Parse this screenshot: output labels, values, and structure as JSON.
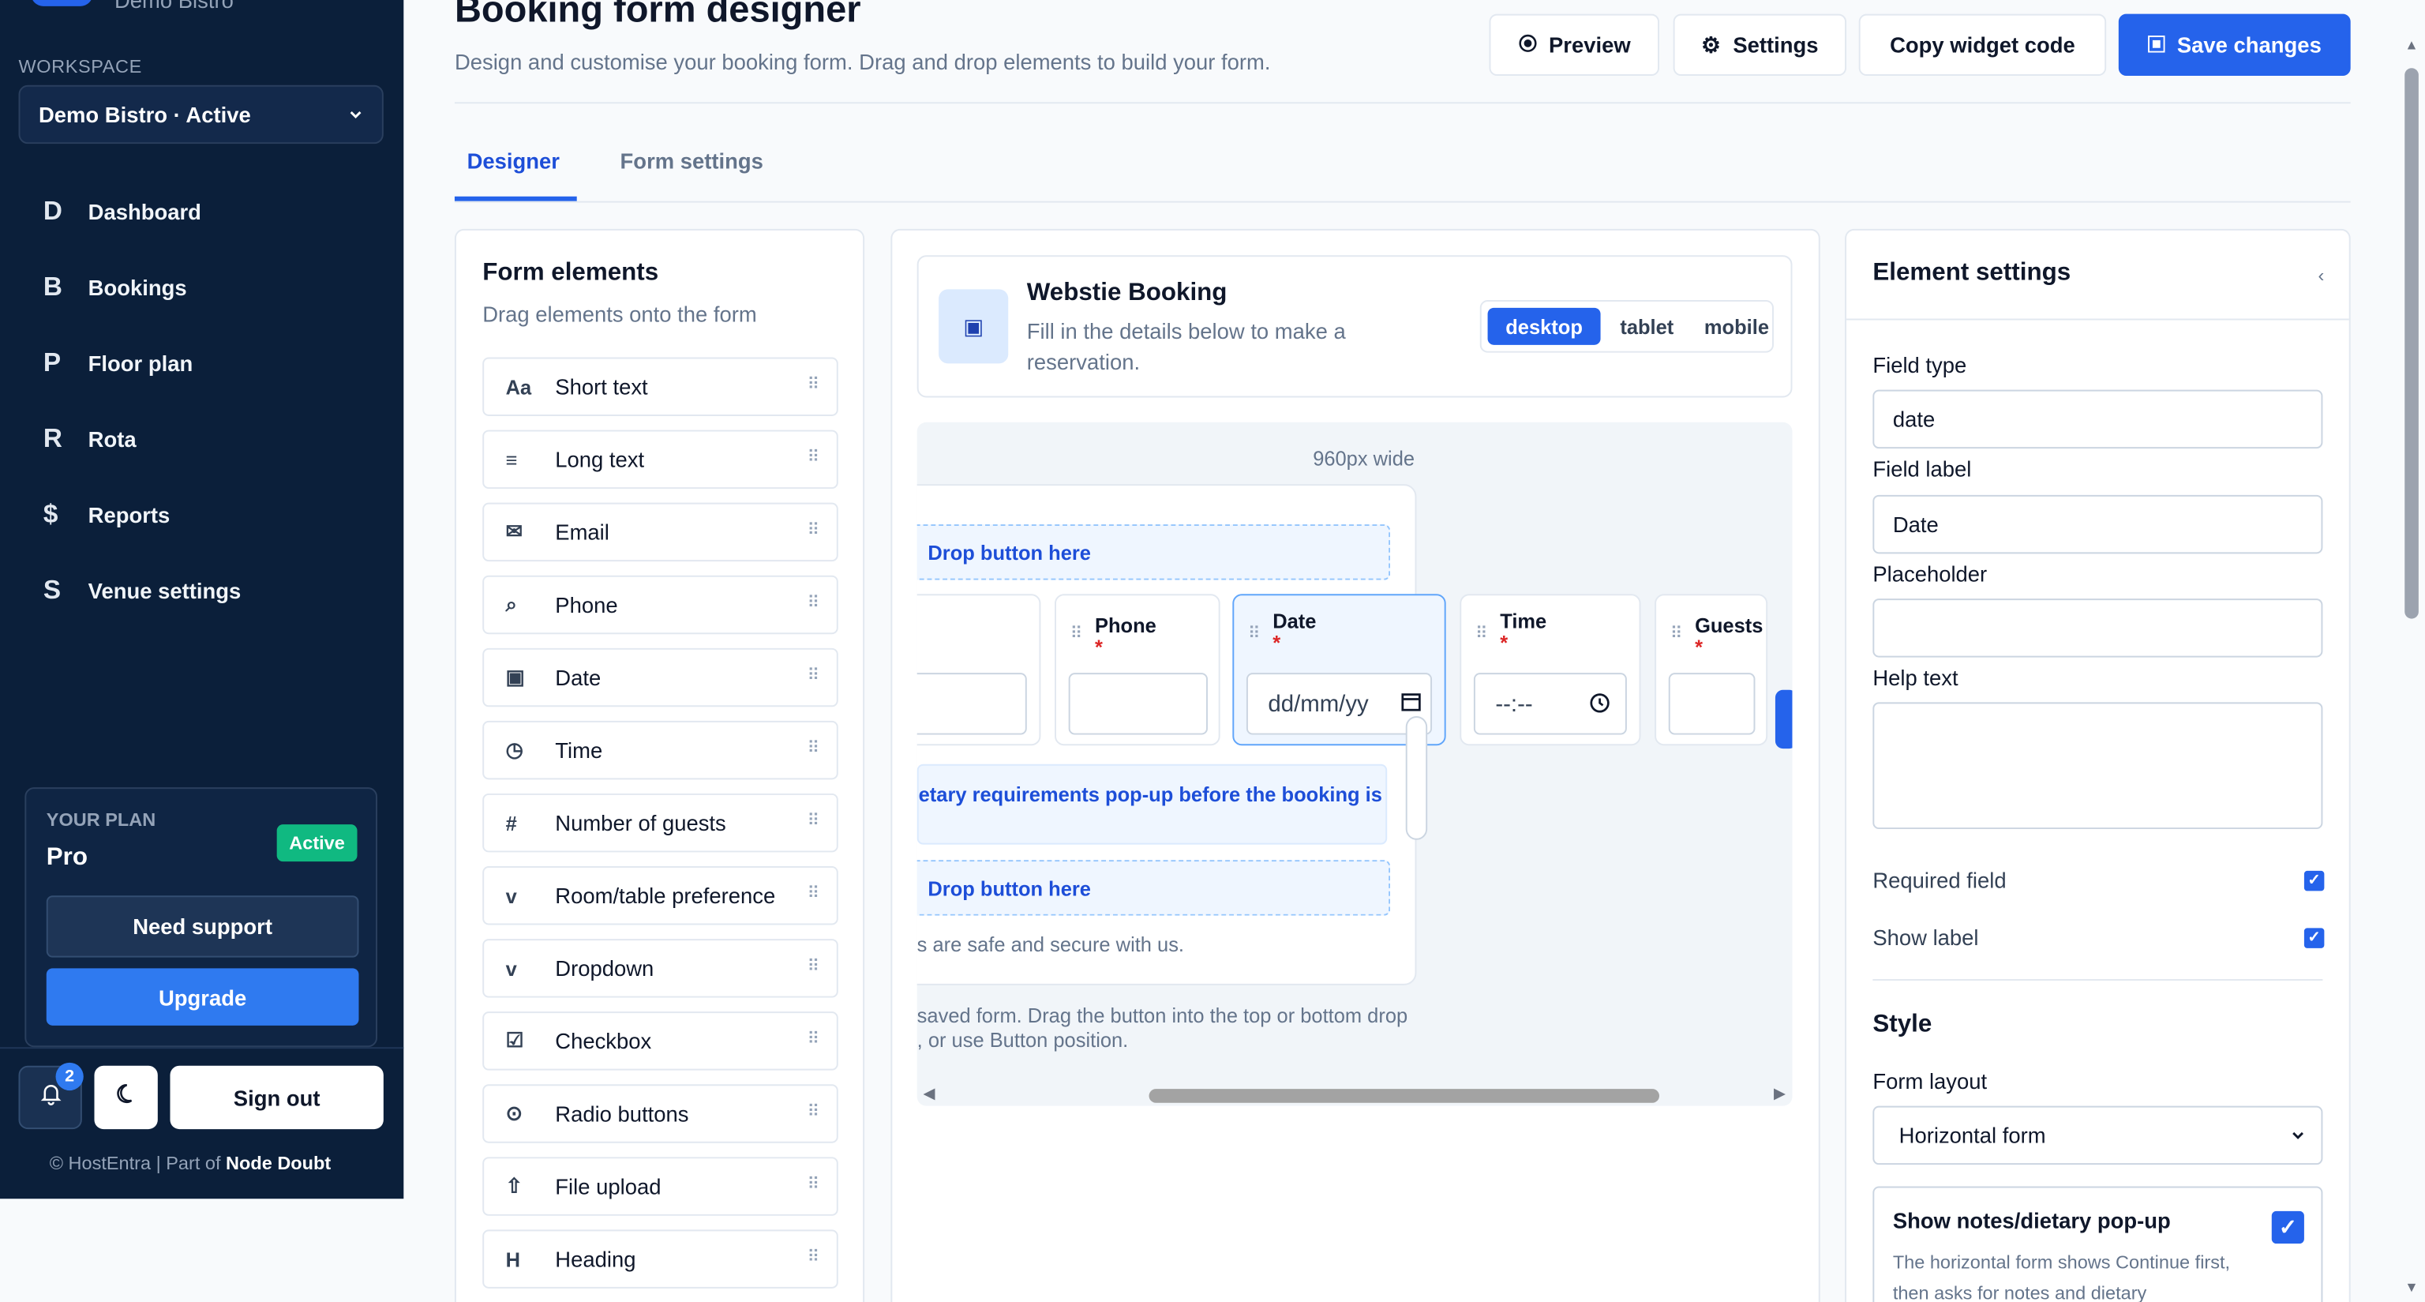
{
  "sidebar": {
    "brand": "Demo Bistro",
    "workspace_label": "WORKSPACE",
    "workspace_value": "Demo Bistro · Active",
    "nav": [
      {
        "icon": "D",
        "label": "Dashboard"
      },
      {
        "icon": "B",
        "label": "Bookings"
      },
      {
        "icon": "P",
        "label": "Floor plan"
      },
      {
        "icon": "R",
        "label": "Rota"
      },
      {
        "icon": "$",
        "label": "Reports"
      },
      {
        "icon": "S",
        "label": "Venue settings"
      }
    ],
    "plan": {
      "label": "YOUR PLAN",
      "name": "Pro",
      "badge": "Active",
      "support_label": "Need support",
      "upgrade_label": "Upgrade"
    },
    "notification_count": "2",
    "sign_out_label": "Sign out",
    "copyright_prefix": "© HostEntra | Part of ",
    "copyright_company": "Node Doubt"
  },
  "header": {
    "title": "Booking form designer",
    "subtitle": "Design and customise your booking form. Drag and drop elements to build your form.",
    "preview_label": "Preview",
    "settings_label": "Settings",
    "copy_label": "Copy widget code",
    "save_label": "Save changes"
  },
  "tabs": [
    {
      "label": "Designer",
      "active": true
    },
    {
      "label": "Form settings",
      "active": false
    }
  ],
  "form_elements": {
    "title": "Form elements",
    "subtitle": "Drag elements onto the form",
    "items": [
      {
        "icon": "Aa",
        "label": "Short text"
      },
      {
        "icon": "≡",
        "label": "Long text"
      },
      {
        "icon": "✉",
        "label": "Email"
      },
      {
        "icon": "⌕",
        "label": "Phone"
      },
      {
        "icon": "▣",
        "label": "Date"
      },
      {
        "icon": "◷",
        "label": "Time"
      },
      {
        "icon": "#",
        "label": "Number of guests"
      },
      {
        "icon": "v",
        "label": "Room/table preference"
      },
      {
        "icon": "v",
        "label": "Dropdown"
      },
      {
        "icon": "☑",
        "label": "Checkbox"
      },
      {
        "icon": "⊙",
        "label": "Radio buttons"
      },
      {
        "icon": "⇧",
        "label": "File upload"
      },
      {
        "icon": "H",
        "label": "Heading"
      }
    ]
  },
  "canvas": {
    "form_title": "Webstie Booking",
    "form_subtitle": "Fill in the details below to make a reservation.",
    "devices": [
      {
        "label": "desktop",
        "active": true
      },
      {
        "label": "tablet",
        "active": false
      },
      {
        "label": "mobile",
        "active": false
      }
    ],
    "width_label": "960px wide",
    "drop_top": "Drop button here",
    "drop_bottom": "Drop button here",
    "fields": {
      "phone_label": "Phone",
      "date_label": "Date",
      "date_value": "dd/mm/yy",
      "time_label": "Time",
      "time_value": "--:--",
      "guests_label": "Guests",
      "required_mark": "*"
    },
    "diet_text": "etary requirements pop-up before the booking is",
    "secure_text": "s are safe and secure with us.",
    "note_line1": "saved form. Drag the button into the top or bottom drop",
    "note_line2": ", or use Button position."
  },
  "element_settings": {
    "title": "Element settings",
    "field_type_label": "Field type",
    "field_type_value": "date",
    "field_label_label": "Field label",
    "field_label_value": "Date",
    "placeholder_label": "Placeholder",
    "placeholder_value": "",
    "help_text_label": "Help text",
    "required_label": "Required field",
    "required_checked": true,
    "show_label_label": "Show label",
    "show_label_checked": true,
    "style_heading": "Style",
    "form_layout_label": "Form layout",
    "form_layout_value": "Horizontal form",
    "notes_title": "Show notes/dietary pop-up",
    "notes_checked": true,
    "notes_desc": "The horizontal form shows Continue first, then asks for notes and dietary"
  },
  "colors": {
    "sidebar_bg": "#0b1f3a",
    "accent": "#2563eb",
    "active_badge": "#10b981"
  }
}
